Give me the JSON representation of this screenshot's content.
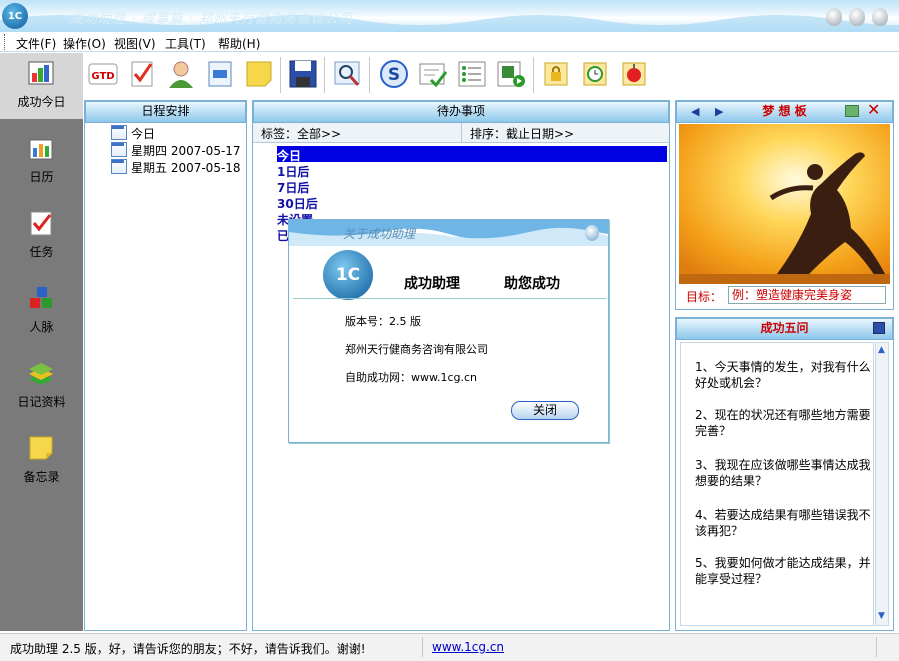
{
  "window": {
    "title": "成功助理  ·  成事篇  ·  郑州天行健商务咨询公司"
  },
  "menu": [
    {
      "label": "文件(F)"
    },
    {
      "label": "操作(O)"
    },
    {
      "label": "视图(V)"
    },
    {
      "label": "工具(T)"
    },
    {
      "label": "帮助(H)"
    }
  ],
  "nav": [
    {
      "label": "成功今日",
      "icon": "chart-board-icon"
    },
    {
      "label": "日历",
      "icon": "calendar-icon"
    },
    {
      "label": "任务",
      "icon": "checklist-icon"
    },
    {
      "label": "人脉",
      "icon": "blocks-icon"
    },
    {
      "label": "日记资料",
      "icon": "books-icon"
    },
    {
      "label": "备忘录",
      "icon": "sticky-note-icon"
    }
  ],
  "toolbar": {
    "gtd_label": "GTD",
    "buttons": [
      "gtd-icon",
      "task-check-icon",
      "person-icon",
      "document-icon",
      "note-icon",
      "save-icon",
      "search-icon",
      "s-logo-icon",
      "form-check-icon",
      "list-icon",
      "export-icon",
      "lock-icon",
      "clock-icon",
      "alarm-icon"
    ]
  },
  "schedule": {
    "header": "日程安排",
    "items": [
      {
        "text": "今日"
      },
      {
        "text": "星期四 2007-05-17"
      },
      {
        "text": "星期五 2007-05-18"
      }
    ]
  },
  "todo": {
    "header": "待办事项",
    "filter_label": "标签：全部>>",
    "sort_label": "排序：截止日期>>",
    "items": [
      {
        "text": "今日"
      },
      {
        "text": "1日后"
      },
      {
        "text": "7日后"
      },
      {
        "text": "30日后"
      },
      {
        "text": "未设置"
      },
      {
        "text": "已"
      }
    ]
  },
  "dream_board": {
    "header": "梦 想 板",
    "goal_label": "目标：",
    "goal_value": "例：塑造健康完美身姿"
  },
  "five_questions": {
    "header": "成功五问",
    "questions": [
      "1、今天事情的发生，对我有什么好处或机会？",
      "2、现在的状况还有哪些地方需要完善？",
      "3、我现在应该做哪些事情达成我想要的结果？",
      "4、若要达成结果有哪些错误我不该再犯？",
      "5、我要如何做才能达成结果，并能享受过程？"
    ]
  },
  "status": {
    "message": "成功助理 2.5 版，好，请告诉您的朋友；不好，请告诉我们。谢谢!",
    "link": "www.1cg.cn"
  },
  "about_dialog": {
    "title": "关于成功助理",
    "logo_text": "1C",
    "slogan_left": "成功助理",
    "slogan_right": "助您成功",
    "version": "版本号：2.5 版",
    "company": "郑州天行健商务咨询有限公司",
    "website": "自助成功网：www.1cg.cn",
    "close_label": "关闭"
  },
  "colors": {
    "accent": "#1a6fb5",
    "selection": "#0000e0",
    "todo_text": "#1010a8",
    "dream_header": "#cc0000",
    "nav_bg": "#7a7a7a"
  }
}
